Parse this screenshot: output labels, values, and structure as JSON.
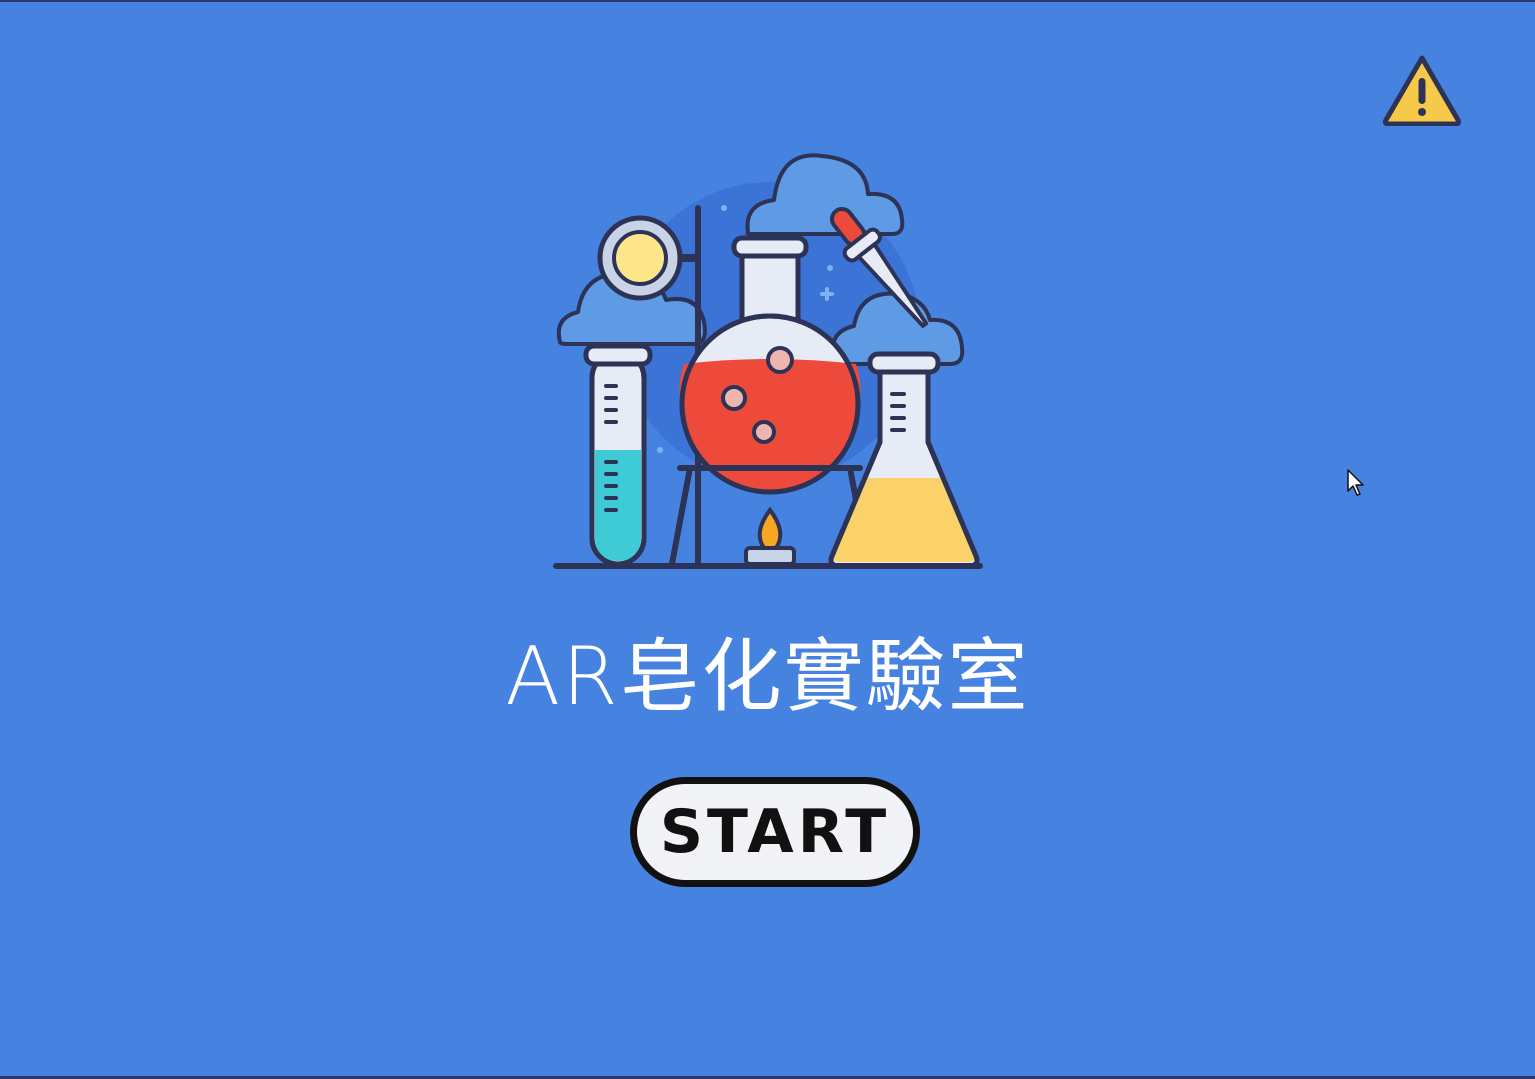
{
  "app": {
    "title": "AR皂化實驗室"
  },
  "start_button": {
    "label": "START"
  },
  "icons": {
    "warning": "warning-triangle-icon",
    "illustration": "chemistry-lab-illustration",
    "cursor": "mouse-pointer-icon"
  },
  "colors": {
    "background": "#4682df",
    "title_text": "#ffffff",
    "button_fill": "#f2f3f7",
    "button_border": "#111111",
    "warning_fill": "#f7c948",
    "outline": "#2d3356",
    "flask_liquid": "#ee4a3b",
    "tube_liquid": "#3ecbd6",
    "erlenmeyer_liquid": "#fbd16a",
    "cloud": "#5f9ae4"
  }
}
